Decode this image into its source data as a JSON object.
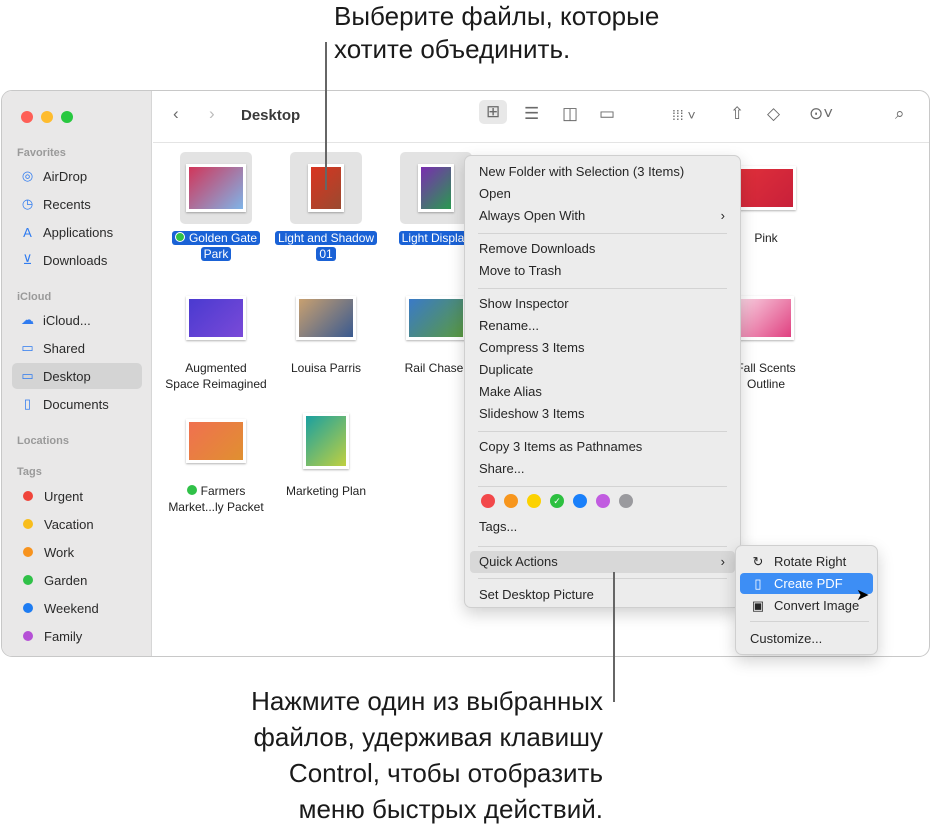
{
  "annotations": {
    "top": [
      "Выберите файлы, которые",
      "хотите объединить."
    ],
    "bottom": [
      "Нажмите один из выбранных",
      "файлов, удерживая клавишу",
      "Control, чтобы отобразить",
      "меню быстрых действий."
    ]
  },
  "window": {
    "title": "Desktop"
  },
  "sidebar": {
    "favorites_header": "Favorites",
    "favorites": [
      {
        "label": "AirDrop",
        "icon": "airdrop-icon"
      },
      {
        "label": "Recents",
        "icon": "clock-icon"
      },
      {
        "label": "Applications",
        "icon": "applications-icon"
      },
      {
        "label": "Downloads",
        "icon": "download-icon"
      }
    ],
    "icloud_header": "iCloud",
    "icloud": [
      {
        "label": "iCloud...",
        "icon": "cloud-icon"
      },
      {
        "label": "Shared",
        "icon": "shared-folder-icon"
      },
      {
        "label": "Desktop",
        "icon": "desktop-icon",
        "selected": true
      },
      {
        "label": "Documents",
        "icon": "document-icon"
      }
    ],
    "locations_header": "Locations",
    "tags_header": "Tags",
    "tags": [
      {
        "label": "Urgent",
        "color": "#f0443a"
      },
      {
        "label": "Vacation",
        "color": "#f8bd1c"
      },
      {
        "label": "Work",
        "color": "#f7931e"
      },
      {
        "label": "Garden",
        "color": "#30c148"
      },
      {
        "label": "Weekend",
        "color": "#1e7cf2"
      },
      {
        "label": "Family",
        "color": "#b550d6"
      }
    ]
  },
  "files": [
    {
      "name1": "Golden Gate",
      "name2": "Park",
      "selected": true,
      "tag": "#30c148"
    },
    {
      "name1": "Light and Shadow",
      "name2": "01",
      "selected": true
    },
    {
      "name1": "Light Display",
      "selected": true
    },
    {
      "name1": "Pink"
    },
    {
      "name1": "Augmented",
      "name2": "Space Reimagined"
    },
    {
      "name1": "Louisa Parris"
    },
    {
      "name1": "Rail Chaser"
    },
    {
      "name1": "Fall Scents",
      "name2": "Outline"
    },
    {
      "name1": "Farmers",
      "name2": "Market...ly Packet",
      "tag": "#30c148"
    },
    {
      "name1": "Marketing Plan"
    }
  ],
  "context_menu": {
    "items": [
      "New Folder with Selection (3 Items)",
      "Open",
      "Always Open With",
      "Remove Downloads",
      "Move to Trash",
      "Show Inspector",
      "Rename...",
      "Compress 3 Items",
      "Duplicate",
      "Make Alias",
      "Slideshow 3 Items",
      "Copy 3 Items as Pathnames",
      "Share...",
      "Tags...",
      "Quick Actions",
      "Set Desktop Picture"
    ],
    "tag_colors": [
      "#f2484a",
      "#f7961d",
      "#fcd200",
      "#2dc040",
      "#1a80fa",
      "#c15ce0",
      "#9a9a9e"
    ]
  },
  "quick_actions": {
    "items": [
      "Rotate Right",
      "Create PDF",
      "Convert Image",
      "Customize..."
    ],
    "highlight_color": "#3d8ef5"
  }
}
